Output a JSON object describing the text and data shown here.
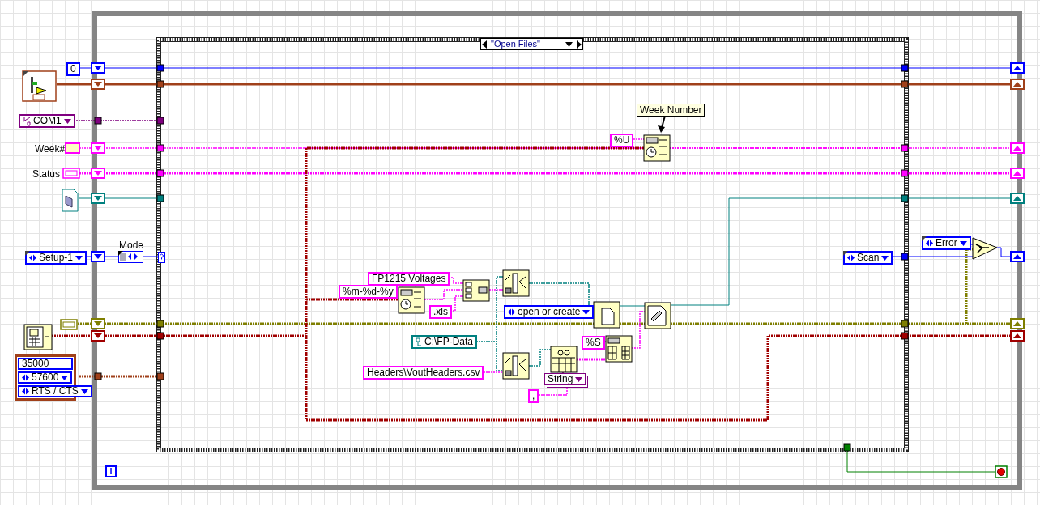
{
  "case_structure": {
    "selector": "\"Open Files\""
  },
  "while_loop": {
    "iteration_terminal": "i"
  },
  "constants": [
    {
      "kind": "numeric",
      "text": "0"
    },
    {
      "kind": "visa",
      "text": "COM1"
    },
    {
      "kind": "ring",
      "text": "Setup-1"
    },
    {
      "kind": "string",
      "text": "%U"
    },
    {
      "kind": "string",
      "text": "FP1215 Voltages"
    },
    {
      "kind": "string",
      "text": "%m-%d-%y"
    },
    {
      "kind": "string",
      "text": ".xls"
    },
    {
      "kind": "ring",
      "text": "open or create"
    },
    {
      "kind": "path",
      "text": "C:\\FP-Data"
    },
    {
      "kind": "string",
      "text": "Headers\\VoutHeaders.csv"
    },
    {
      "kind": "string",
      "text": "%S"
    },
    {
      "kind": "type",
      "text": "String"
    },
    {
      "kind": "string",
      "text": ","
    },
    {
      "kind": "ring",
      "text": "Scan"
    },
    {
      "kind": "ring",
      "text": "Error"
    }
  ],
  "labels": [
    {
      "kind": "plain",
      "text": "Week#"
    },
    {
      "kind": "plain",
      "text": "Status"
    },
    {
      "kind": "plain",
      "text": "Mode"
    },
    {
      "kind": "note",
      "text": "Week Number"
    }
  ],
  "cluster": {
    "items": [
      {
        "kind": "numeric",
        "text": "35000"
      },
      {
        "kind": "ring",
        "text": "57600"
      },
      {
        "kind": "ring",
        "text": "RTS / CTS"
      }
    ]
  }
}
